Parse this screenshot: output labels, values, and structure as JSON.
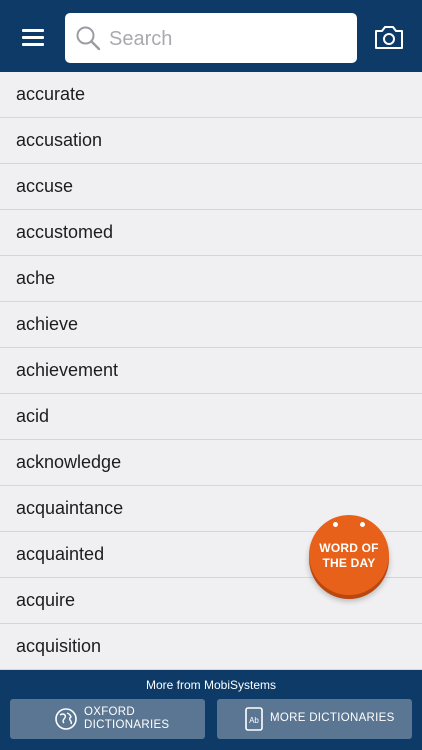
{
  "header": {
    "search_placeholder": "Search",
    "search_value": "",
    "background_color": "#0d3a67",
    "menu_icon": "hamburger-menu-icon",
    "search_icon": "search-icon",
    "camera_icon": "camera-icon"
  },
  "words": [
    {
      "word": "accurate"
    },
    {
      "word": "accusation"
    },
    {
      "word": "accuse"
    },
    {
      "word": "accustomed"
    },
    {
      "word": "ache"
    },
    {
      "word": "achieve"
    },
    {
      "word": "achievement"
    },
    {
      "word": "acid"
    },
    {
      "word": "acknowledge"
    },
    {
      "word": "acquaintance"
    },
    {
      "word": "acquainted"
    },
    {
      "word": "acquire"
    },
    {
      "word": "acquisition"
    }
  ],
  "word_of_the_day": {
    "line1": "WORD OF",
    "line2": "THE DAY",
    "color": "#e8611a"
  },
  "footer": {
    "title": "More from MobiSystems",
    "oxford_line1": "OXFORD",
    "oxford_line2": "DICTIONARIES",
    "oxford_icon": "globe-icon",
    "more_label": "MORE DICTIONARIES",
    "more_icon": "dictionary-book-icon",
    "button_color": "#5b7693"
  }
}
